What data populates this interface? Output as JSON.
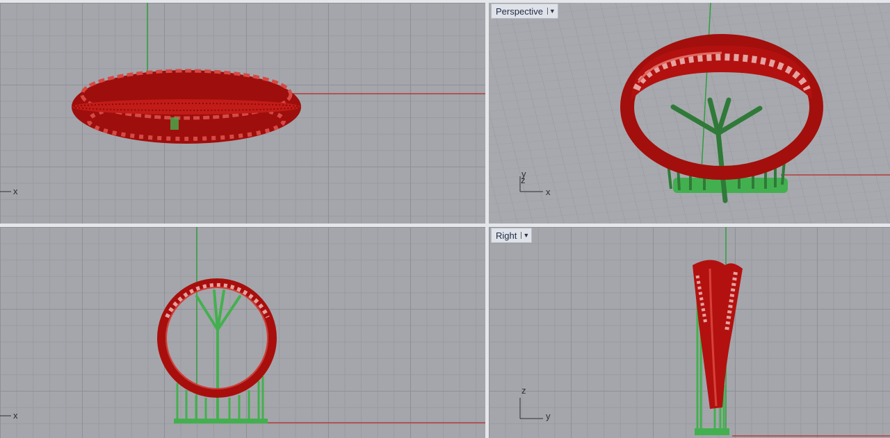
{
  "viewports": {
    "top": {
      "name": ""
    },
    "perspective": {
      "name": "Perspective"
    },
    "front": {
      "name": ""
    },
    "right": {
      "name": "Right"
    }
  },
  "axes": {
    "top": [
      "x"
    ],
    "perspective": [
      "y",
      "z",
      "x"
    ],
    "front": [
      "x"
    ],
    "right": [
      "z",
      "y"
    ]
  },
  "colors": {
    "ring": "#b3110f",
    "support": "#43b04f",
    "x_axis": "#b33a3a",
    "y_axis": "#2e9e3d",
    "viewport_bg": "#a4a6ab"
  },
  "icons": {
    "viewport_menu": "dropdown-arrow-icon"
  }
}
